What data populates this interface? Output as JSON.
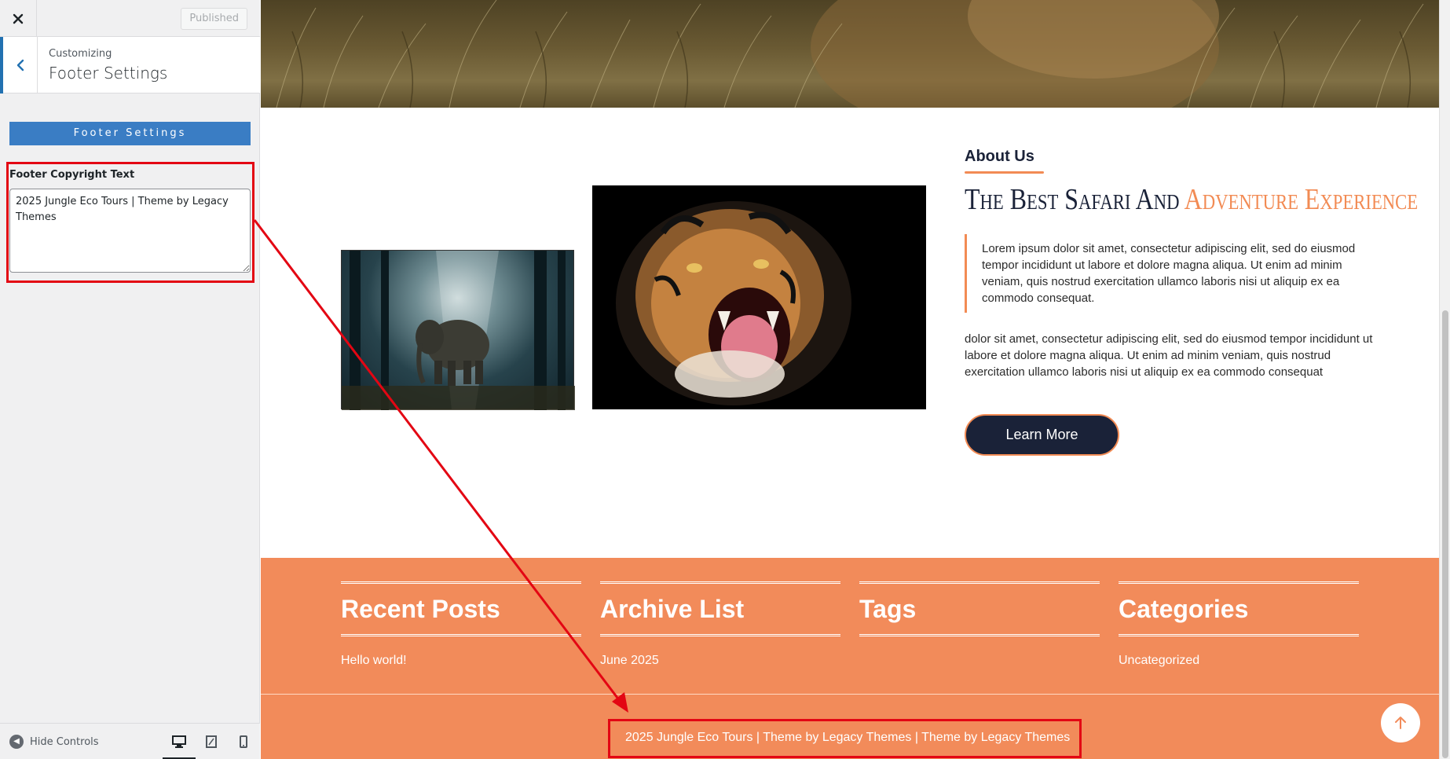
{
  "sidebar": {
    "close_icon": "close-icon",
    "published_label": "Published",
    "customizing_label": "Customizing",
    "section_title": "Footer Settings",
    "section_button_label": "Footer Settings",
    "copyright_label": "Footer Copyright Text",
    "copyright_value": "2025 Jungle Eco Tours | Theme by Legacy Themes",
    "hide_controls_label": "Hide Controls",
    "devices": [
      "desktop-icon",
      "tablet-icon",
      "mobile-icon"
    ]
  },
  "about": {
    "heading": "About Us",
    "title_main": "The Best Safari And ",
    "title_accent": "Adventure Experience",
    "quote": "Lorem ipsum dolor sit amet, consectetur adipiscing elit, sed do eiusmod tempor incididunt ut labore et dolore magna aliqua. Ut enim ad minim veniam, quis nostrud exercitation ullamco laboris nisi ut aliquip ex ea commodo consequat.",
    "body": "dolor sit amet, consectetur adipiscing elit, sed do eiusmod tempor incididunt ut labore et dolore magna aliqua. Ut enim ad minim veniam, quis nostrud exercitation ullamco laboris nisi ut aliquip ex ea commodo consequat",
    "button_label": "Learn More"
  },
  "footer": {
    "widgets": [
      {
        "title": "Recent Posts",
        "item": "Hello world!"
      },
      {
        "title": "Archive List",
        "item": "June 2025"
      },
      {
        "title": "Tags",
        "item": ""
      },
      {
        "title": "Categories",
        "item": "Uncategorized"
      }
    ],
    "copyright": "2025 Jungle Eco Tours | Theme by Legacy Themes | Theme by Legacy Themes"
  },
  "colors": {
    "accent": "#f28b5a",
    "navy": "#1a2238",
    "wp_blue": "#3a7dc4",
    "annotation_red": "#e30613"
  }
}
